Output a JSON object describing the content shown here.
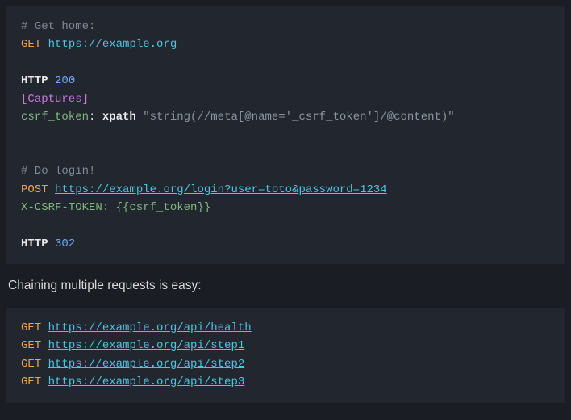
{
  "block1": {
    "c1": "# Get home:",
    "m1": "GET",
    "u1": "https://example.org",
    "kw": "HTTP",
    "s1": "200",
    "sec": "[Captures]",
    "capname": "csrf_token",
    "colon": ":",
    "fn": "xpath",
    "expr": "\"string(//meta[@name='_csrf_token']/@content)\"",
    "c2": "# Do login!",
    "m2": "POST",
    "u2": "https://example.org/login?user=toto&password=1234",
    "hdr": "X-CSRF-TOKEN:",
    "tmpl": "{{csrf_token}}",
    "s2": "302"
  },
  "prose": "Chaining multiple requests is easy:",
  "block2": {
    "m": "GET",
    "u1": "https://example.org/api/health",
    "u2": "https://example.org/api/step1",
    "u3": "https://example.org/api/step2",
    "u4": "https://example.org/api/step3"
  }
}
